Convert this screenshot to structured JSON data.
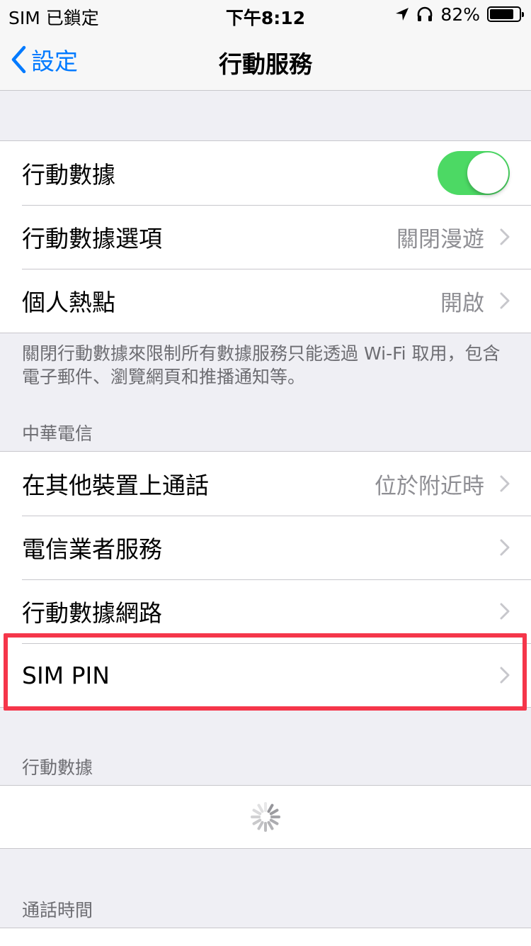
{
  "status_bar": {
    "carrier": "SIM 已鎖定",
    "time": "下午8:12",
    "battery_percent": "82%",
    "battery_level": 0.82,
    "icons": [
      "location-arrow-icon",
      "headphones-icon",
      "battery-icon"
    ]
  },
  "nav": {
    "back_label": "設定",
    "title": "行動服務"
  },
  "group1": {
    "rows": [
      {
        "label": "行動數據",
        "toggle_on": true
      },
      {
        "label": "行動數據選項",
        "value": "關閉漫遊"
      },
      {
        "label": "個人熱點",
        "value": "開啟"
      }
    ]
  },
  "group1_footer": "關閉行動數據來限制所有數據服務只能透過 Wi-Fi 取用，包含電子郵件、瀏覽網頁和推播通知等。",
  "carrier_section": {
    "header": "中華電信",
    "rows": [
      {
        "label": "在其他裝置上通話",
        "value": "位於附近時"
      },
      {
        "label": "電信業者服務"
      },
      {
        "label": "行動數據網路"
      },
      {
        "label": "SIM PIN"
      }
    ]
  },
  "data_section": {
    "header": "行動數據"
  },
  "call_time_section": {
    "header": "通話時間"
  },
  "colors": {
    "accent": "#007aff",
    "toggle_on": "#4cd964",
    "highlight": "#f5364a",
    "background": "#efeff4"
  }
}
